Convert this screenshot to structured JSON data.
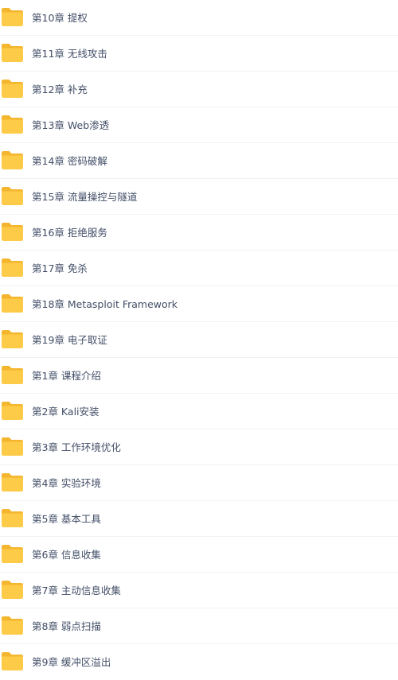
{
  "folder_color": "#fecb48",
  "folder_tab_color": "#f4b62e",
  "text_color": "#424e67",
  "folders": [
    {
      "icon": "folder-icon",
      "name": "第10章 提权"
    },
    {
      "icon": "folder-icon",
      "name": "第11章 无线攻击"
    },
    {
      "icon": "folder-icon",
      "name": "第12章 补充"
    },
    {
      "icon": "folder-icon",
      "name": "第13章 Web渗透"
    },
    {
      "icon": "folder-icon",
      "name": "第14章 密码破解"
    },
    {
      "icon": "folder-icon",
      "name": "第15章 流量操控与隧道"
    },
    {
      "icon": "folder-icon",
      "name": "第16章 拒绝服务"
    },
    {
      "icon": "folder-icon",
      "name": "第17章 免杀"
    },
    {
      "icon": "folder-icon",
      "name": "第18章 Metasploit Framework"
    },
    {
      "icon": "folder-icon",
      "name": "第19章 电子取证"
    },
    {
      "icon": "folder-icon",
      "name": "第1章 课程介绍"
    },
    {
      "icon": "folder-icon",
      "name": "第2章 Kali安装"
    },
    {
      "icon": "folder-icon",
      "name": "第3章 工作环境优化"
    },
    {
      "icon": "folder-icon",
      "name": "第4章 实验环境"
    },
    {
      "icon": "folder-icon",
      "name": "第5章 基本工具"
    },
    {
      "icon": "folder-icon",
      "name": "第6章 信息收集"
    },
    {
      "icon": "folder-icon",
      "name": "第7章 主动信息收集"
    },
    {
      "icon": "folder-icon",
      "name": "第8章 弱点扫描"
    },
    {
      "icon": "folder-icon",
      "name": "第9章 缓冲区溢出"
    }
  ]
}
